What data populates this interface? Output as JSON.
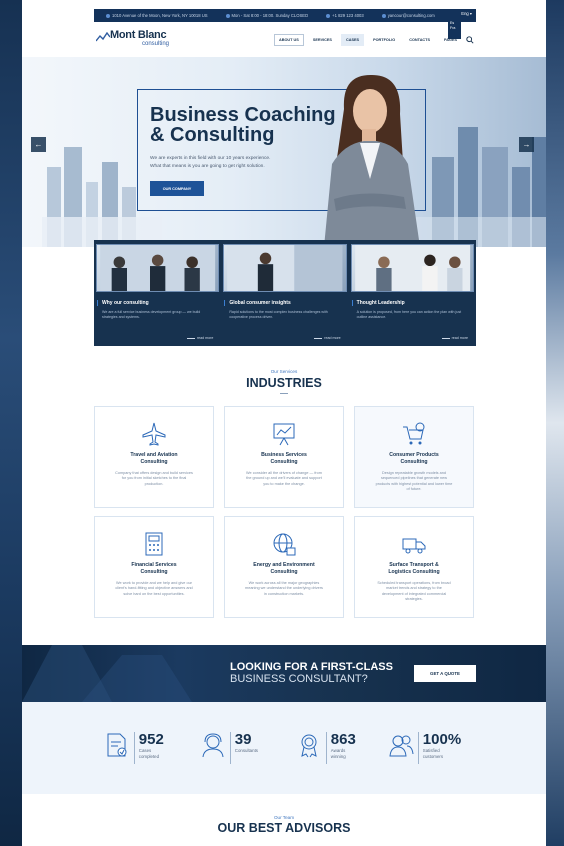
{
  "topbar": {
    "address": "1010 Avenue of the Moon, New York, NY 10018 US",
    "hours": "Mon - Sat 8:00 - 18:00. Sunday CLOSED",
    "phone": "+1 829 123 4003",
    "email": "yancour@consulting.com",
    "lang": "Eng",
    "lang_options": [
      "Es",
      "Fra"
    ]
  },
  "logo": {
    "name": "Mont Blanc",
    "sub": "consulting"
  },
  "nav": [
    "ABOUT US",
    "SERVICES",
    "CASES",
    "PORTFOLIO",
    "CONTACTS",
    "PAGES"
  ],
  "hero": {
    "title_line1": "Business Coaching",
    "title_line2": "& Consulting",
    "text_line1": "We are experts in this field with our 10 years experience.",
    "text_line2": "What that means is you are going to get right solution.",
    "button": "OUR COMPANY"
  },
  "features": [
    {
      "title": "Why our consulting",
      "desc": "We are a full service business development group — we build strategies and systems.",
      "more": "read more"
    },
    {
      "title": "Global consumer insights",
      "desc": "Rapid solutions to the most complex business challenges with cooperative process driven.",
      "more": "read more"
    },
    {
      "title": "Thought Leadership",
      "desc": "A solution is proposed, from here you can action the plan with just outline assistance.",
      "more": "read more"
    }
  ],
  "industries": {
    "eyebrow": "Our Services",
    "title": "INDUSTRIES",
    "cards": [
      {
        "icon": "airplane-icon",
        "title1": "Travel and Aviation",
        "title2": "Consulting",
        "desc": "Company that offers design and build services for you from initial sketches to the final production."
      },
      {
        "icon": "chart-board-icon",
        "title1": "Business Services",
        "title2": "Consulting",
        "desc": "We consider all the drivers of change — from the ground up and we'll evaluate and support you to make the change."
      },
      {
        "icon": "cart-coin-icon",
        "title1": "Consumer Products",
        "title2": "Consulting",
        "desc": "Design repeatable growth models and sequenced pipelines that generate new products with highest potential and lower time of future."
      },
      {
        "icon": "calculator-icon",
        "title1": "Financial Services",
        "title2": "Consulting",
        "desc": "We work to provide and we help and give our client's hand-fitting and objective answers and solve hard on the best opportunities."
      },
      {
        "icon": "globe-lock-icon",
        "title1": "Energy and Environment",
        "title2": "Consulting",
        "desc": "We work across all the major geographies meaning we understand the underlying drivers in construction markets."
      },
      {
        "icon": "truck-icon",
        "title1": "Surface Transport &",
        "title2": "Logistics Consulting",
        "desc": "Scheduled transport operations, from broad market trends and strategy to the development of integrated commercial strategies."
      }
    ]
  },
  "cta": {
    "line1": "LOOKING FOR A FIRST-CLASS",
    "line2": "BUSINESS CONSULTANT?",
    "button": "GET A QUOTE"
  },
  "stats": [
    {
      "icon": "document-check-icon",
      "number": "952",
      "label1": "Cases",
      "label2": "completed"
    },
    {
      "icon": "headset-agent-icon",
      "number": "39",
      "label1": "Consultants",
      "label2": ""
    },
    {
      "icon": "award-ribbon-icon",
      "number": "863",
      "label1": "Awards",
      "label2": "winning"
    },
    {
      "icon": "users-icon",
      "number": "100%",
      "label1": "Satisfied",
      "label2": "customers"
    }
  ],
  "advisors": {
    "eyebrow": "Our Team",
    "title": "OUR BEST ADVISORS"
  },
  "colors": {
    "navy": "#17324f",
    "accent": "#1e5398",
    "light": "#eef4fb"
  }
}
